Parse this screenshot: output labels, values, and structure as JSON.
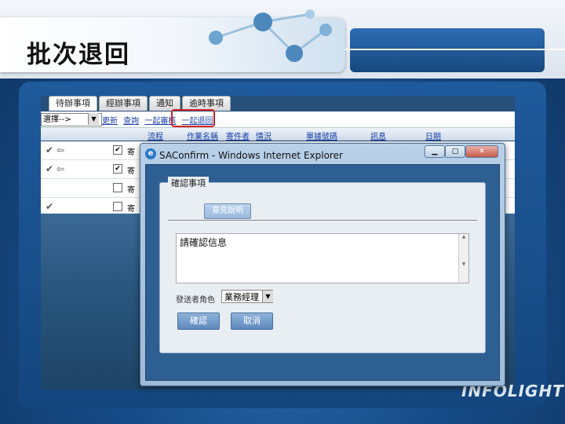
{
  "slide": {
    "title": "批次退回",
    "logo": "INFOLIGHT"
  },
  "app": {
    "tabs": [
      "待辦事項",
      "經辦事項",
      "通知",
      "逾時事項"
    ],
    "toolbar": {
      "select_value": "選擇-->",
      "links": [
        "更新",
        "查詢",
        "一起審核",
        "一起退回"
      ]
    },
    "grid": {
      "headers": [
        "流程",
        "作業名稱",
        "寄件者",
        "情況",
        "單據號碼",
        "訊息",
        "日期"
      ],
      "rows": [
        {
          "checked": true,
          "text": "寄"
        },
        {
          "checked": true,
          "text": "寄"
        },
        {
          "checked": false,
          "text": "寄"
        },
        {
          "checked": false,
          "text": "寄"
        }
      ]
    }
  },
  "dialog": {
    "title": "SAConfirm - Windows Internet Explorer",
    "legend": "確認事項",
    "subtab": "意見說明",
    "message": "請確認信息",
    "role_label": "發送者角色",
    "role_value": "業務經理",
    "confirm": "確認",
    "cancel": "取消"
  }
}
